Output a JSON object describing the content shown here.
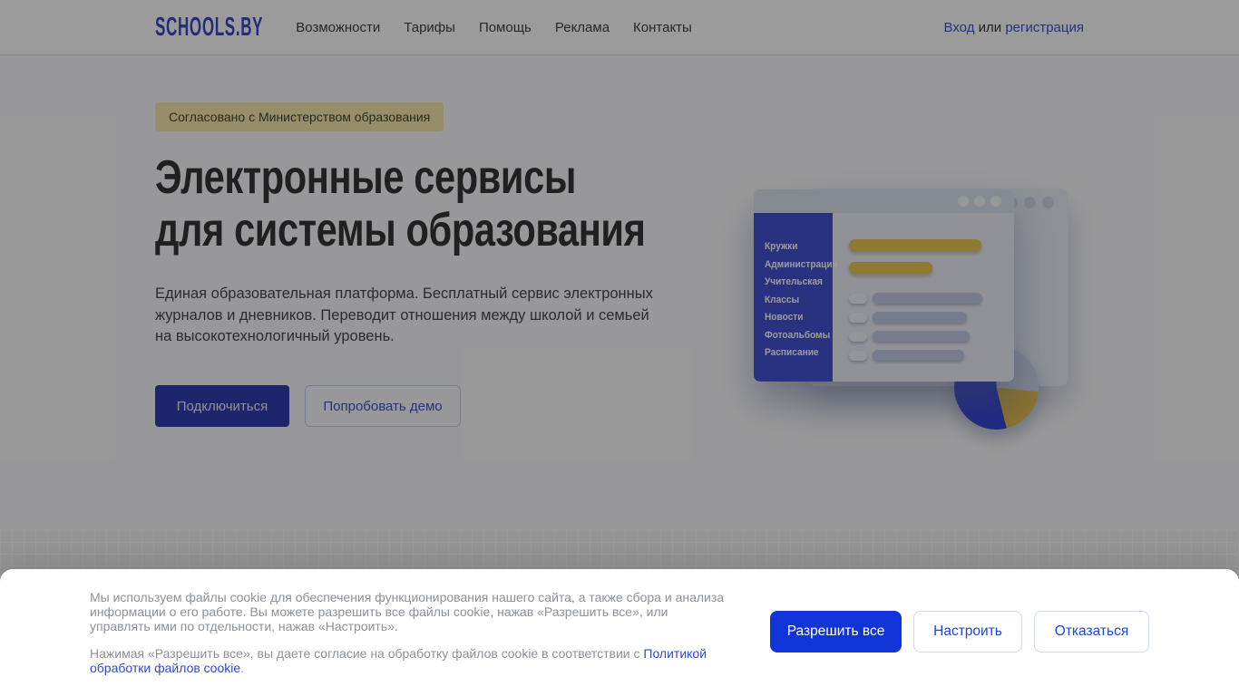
{
  "header": {
    "logo": "SCHOOLS.BY",
    "nav": [
      "Возможности",
      "Тарифы",
      "Помощь",
      "Реклама",
      "Контакты"
    ],
    "auth": {
      "login": "Вход",
      "separator": " или ",
      "register": "регистрация"
    }
  },
  "hero": {
    "badge": "Согласовано с Министерством образования",
    "title": "Электронные сервисы\nдля системы образования",
    "description": "Единая образовательная платформа. Бесплатный сервис электронных журналов и дневников. Переводит отношения между школой и семьей на высокотехнологичный уровень.",
    "primary_button": "Подключиться",
    "secondary_button": "Попробовать демо"
  },
  "illustration": {
    "sidebar_items": [
      "Кружки",
      "Администрация",
      "Учительская",
      "Классы",
      "Новости",
      "Фотоальбомы",
      "Расписание"
    ]
  },
  "cookie_banner": {
    "paragraph1": "Мы используем файлы cookie для обеспечения функционирования нашего сайта, а также сбора и анализа информации о его работе. Вы можете разрешить все файлы cookie, нажав «Разрешить все», или управлять ими по отдельности, нажав «Настроить».",
    "paragraph2_prefix": "Нажимая «Разрешить все», вы даете согласие на обработку файлов cookie в соответствии с ",
    "paragraph2_link": "Политикой обработки файлов cookie",
    "paragraph2_suffix": ".",
    "buttons": {
      "accept": "Разрешить все",
      "configure": "Настроить",
      "decline": "Отказаться"
    }
  },
  "colors": {
    "brand_blue": "#3848c4",
    "primary_button_blue": "#2e3db2",
    "cookie_accept_blue": "#1134d8",
    "accent_yellow": "#ecc852",
    "badge_yellow": "#f6e9ab",
    "link_blue": "#2b4ad9",
    "overlay": "rgba(5,5,5,0.40)"
  }
}
